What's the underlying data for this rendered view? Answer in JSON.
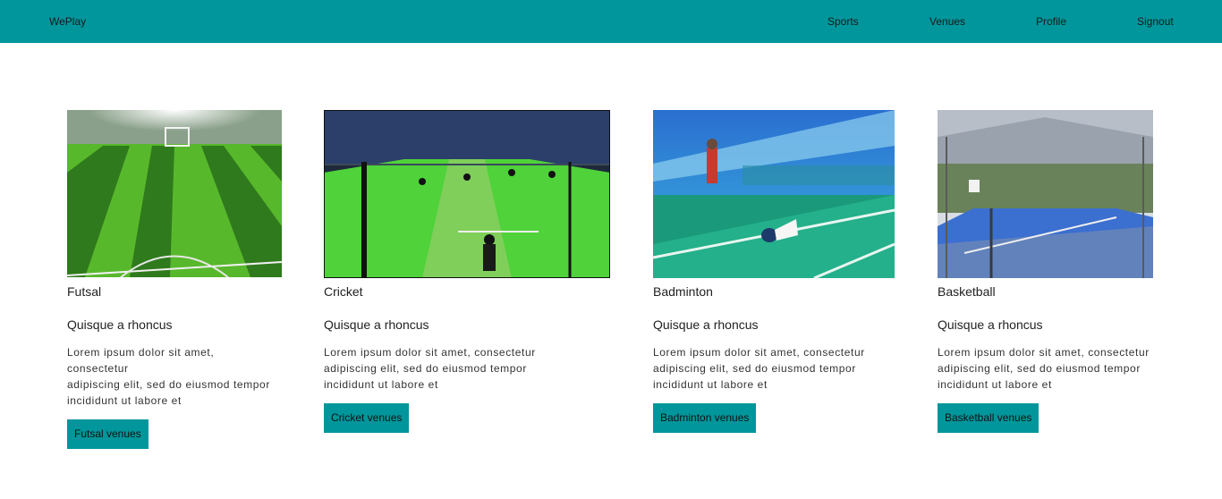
{
  "nav": {
    "brand": "WePlay",
    "links": [
      "Sports",
      "Venues",
      "Profile",
      "Signout"
    ]
  },
  "cards": [
    {
      "title": "Futsal",
      "subtitle": "Quisque a rhoncus",
      "text_lines": [
        "Lorem ipsum dolor sit amet,",
        "consectetur",
        "adipiscing elit, sed do eiusmod tempor",
        "incididunt ut labore et"
      ],
      "button": "Futsal venues",
      "image": "futsal-field-photo"
    },
    {
      "title": "Cricket",
      "subtitle": "Quisque a rhoncus",
      "text_lines": [
        "Lorem ipsum dolor sit amet, consectetur",
        "adipiscing elit, sed do eiusmod tempor",
        "incididunt ut labore et"
      ],
      "button": "Cricket venues",
      "image": "indoor-cricket-photo"
    },
    {
      "title": "Badminton",
      "subtitle": "Quisque a rhoncus",
      "text_lines": [
        "Lorem ipsum dolor sit amet, consectetur",
        "adipiscing elit, sed do eiusmod tempor",
        "incididunt ut labore et"
      ],
      "button": "Badminton venues",
      "image": "badminton-court-photo"
    },
    {
      "title": "Basketball",
      "subtitle": "Quisque a rhoncus",
      "text_lines": [
        "Lorem ipsum dolor sit amet, consectetur",
        "adipiscing elit, sed do eiusmod tempor",
        "incididunt ut labore et"
      ],
      "button": "Basketball venues",
      "image": "basketball-court-photo"
    }
  ],
  "colors": {
    "accent": "#00969b",
    "background": "#ffffff"
  }
}
